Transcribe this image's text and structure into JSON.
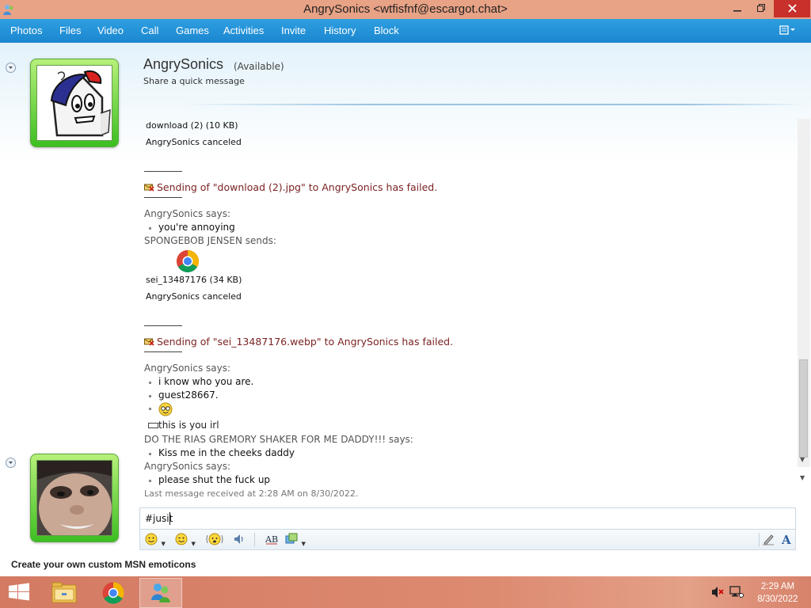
{
  "window": {
    "title": "AngrySonics <wtfisfnf@escargot.chat>",
    "minimize": "🗕",
    "maximize": "🗗",
    "close": "✕"
  },
  "menu": {
    "items": [
      "Photos",
      "Files",
      "Video",
      "Call",
      "Games",
      "Activities",
      "Invite",
      "History",
      "Block"
    ],
    "options_glyph": "▾"
  },
  "contact": {
    "name": "AngrySonics",
    "status": "(Available)",
    "personal_message": "Share a quick message"
  },
  "conversation": {
    "file1_name": "download (2) (10 KB)",
    "file1_status": "AngrySonics canceled",
    "fail1": "Sending of \"download (2).jpg\" to AngrySonics has failed.",
    "says1": "AngrySonics says:",
    "msg1": "you're annoying",
    "sends1": "SPONGEBOB JENSEN sends:",
    "file2_name": "sei_13487176 (34 KB)",
    "file2_status": "AngrySonics canceled",
    "fail2": "Sending of \"sei_13487176.webp\" to AngrySonics has failed.",
    "says2": "AngrySonics says:",
    "msg2a": "i know who you are.",
    "msg2b": "guest28667.",
    "msg2c_emoticon": "😐",
    "msg2d": "this is you irl",
    "says3": "DO THE RIAS GREMORY SHAKER FOR ME DADDY!!! says:",
    "msg3": "Kiss me in the cheeks daddy",
    "says4": "AngrySonics says:",
    "msg4": "please shut the fuck up",
    "last_received": "Last message received at 2:28 AM on 8/30/2022."
  },
  "compose": {
    "value": "#jusit"
  },
  "toolbar": {
    "emoticons": "☺",
    "winks": "☺",
    "nudge": "☹",
    "voice_clip": "🔊",
    "font_glyph": "A",
    "handwriting": "✎"
  },
  "footer": {
    "link": "Create your own custom MSN emoticons"
  },
  "taskbar": {
    "clock_time": "2:29 AM",
    "clock_date": "8/30/2022"
  },
  "colors": {
    "titlebar": "#e8a285",
    "menubar": "#1b86d0",
    "avatar_frame": "#3cbf21",
    "fail_text": "#7b2323",
    "taskbar": "#d47a63"
  }
}
